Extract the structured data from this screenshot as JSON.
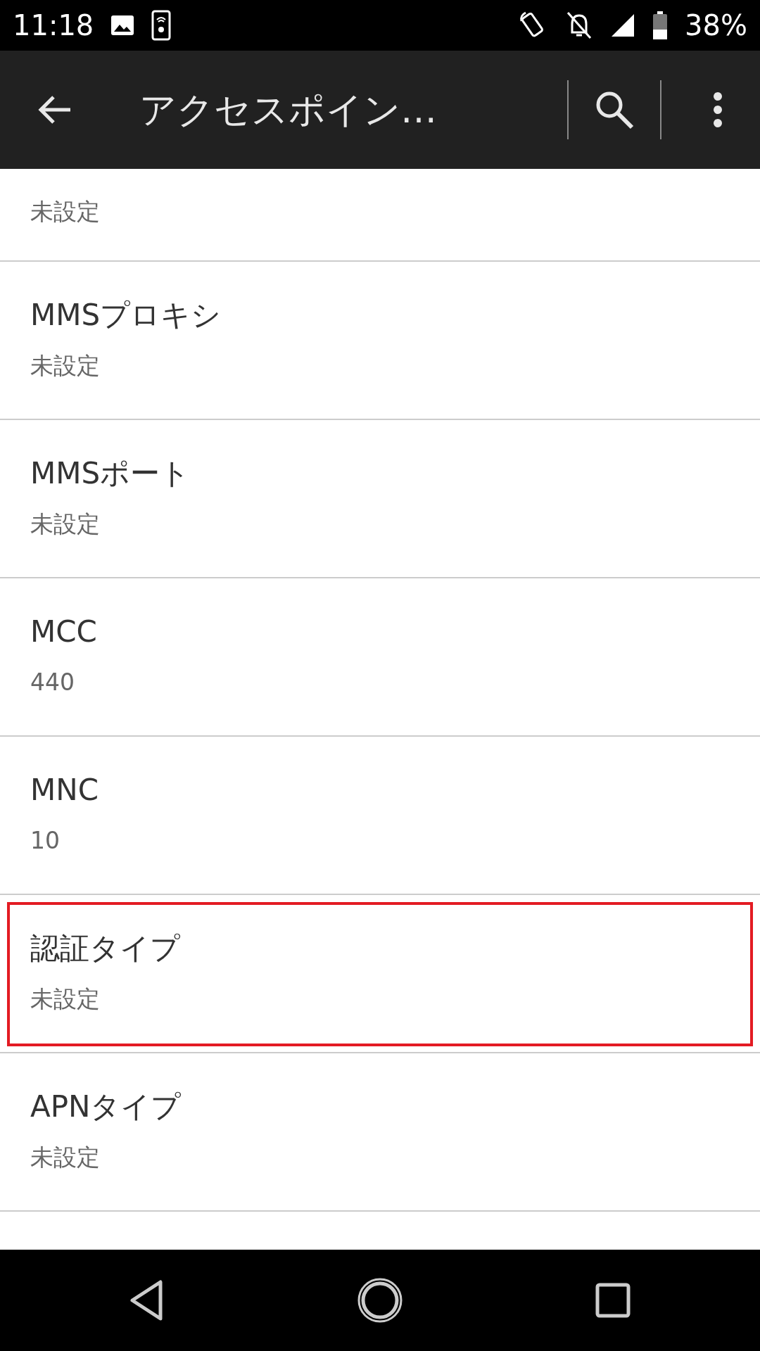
{
  "status_bar": {
    "time": "11:18",
    "battery": "38%"
  },
  "toolbar": {
    "title": "アクセスポイン…"
  },
  "settings": [
    {
      "value": "未設定",
      "highlighted": false
    },
    {
      "title": "MMSプロキシ",
      "value": "未設定",
      "highlighted": false
    },
    {
      "title": "MMSポート",
      "value": "未設定",
      "highlighted": false
    },
    {
      "title": "MCC",
      "value": "440",
      "highlighted": false
    },
    {
      "title": "MNC",
      "value": "10",
      "highlighted": false
    },
    {
      "title": "認証タイプ",
      "value": "未設定",
      "highlighted": true
    },
    {
      "title": "APNタイプ",
      "value": "未設定",
      "highlighted": false
    }
  ]
}
